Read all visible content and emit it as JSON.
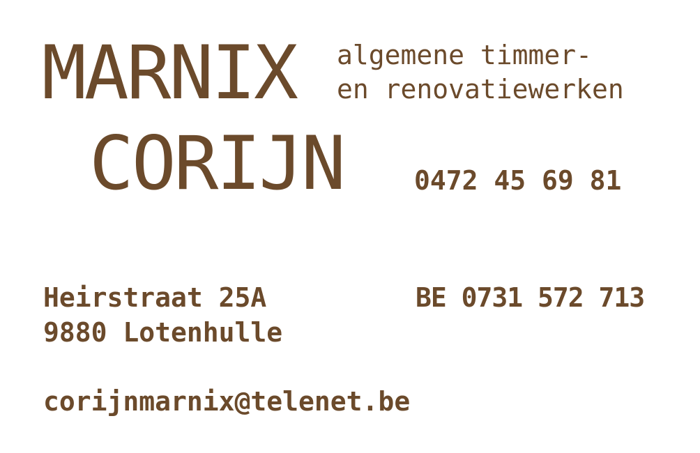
{
  "brand": {
    "first_name": "MARNIX",
    "last_name": "CORIJN",
    "tagline_line1": "algemene timmer-",
    "tagline_line2": "en renovatiewerken",
    "color": "#6b4a2b"
  },
  "contact": {
    "phone": "0472 45 69 81",
    "street": "Heirstraat 25A",
    "city": "9880 Lotenhulle",
    "vat": "BE 0731 572 713",
    "email": "corijnmarnix@telenet.be"
  }
}
